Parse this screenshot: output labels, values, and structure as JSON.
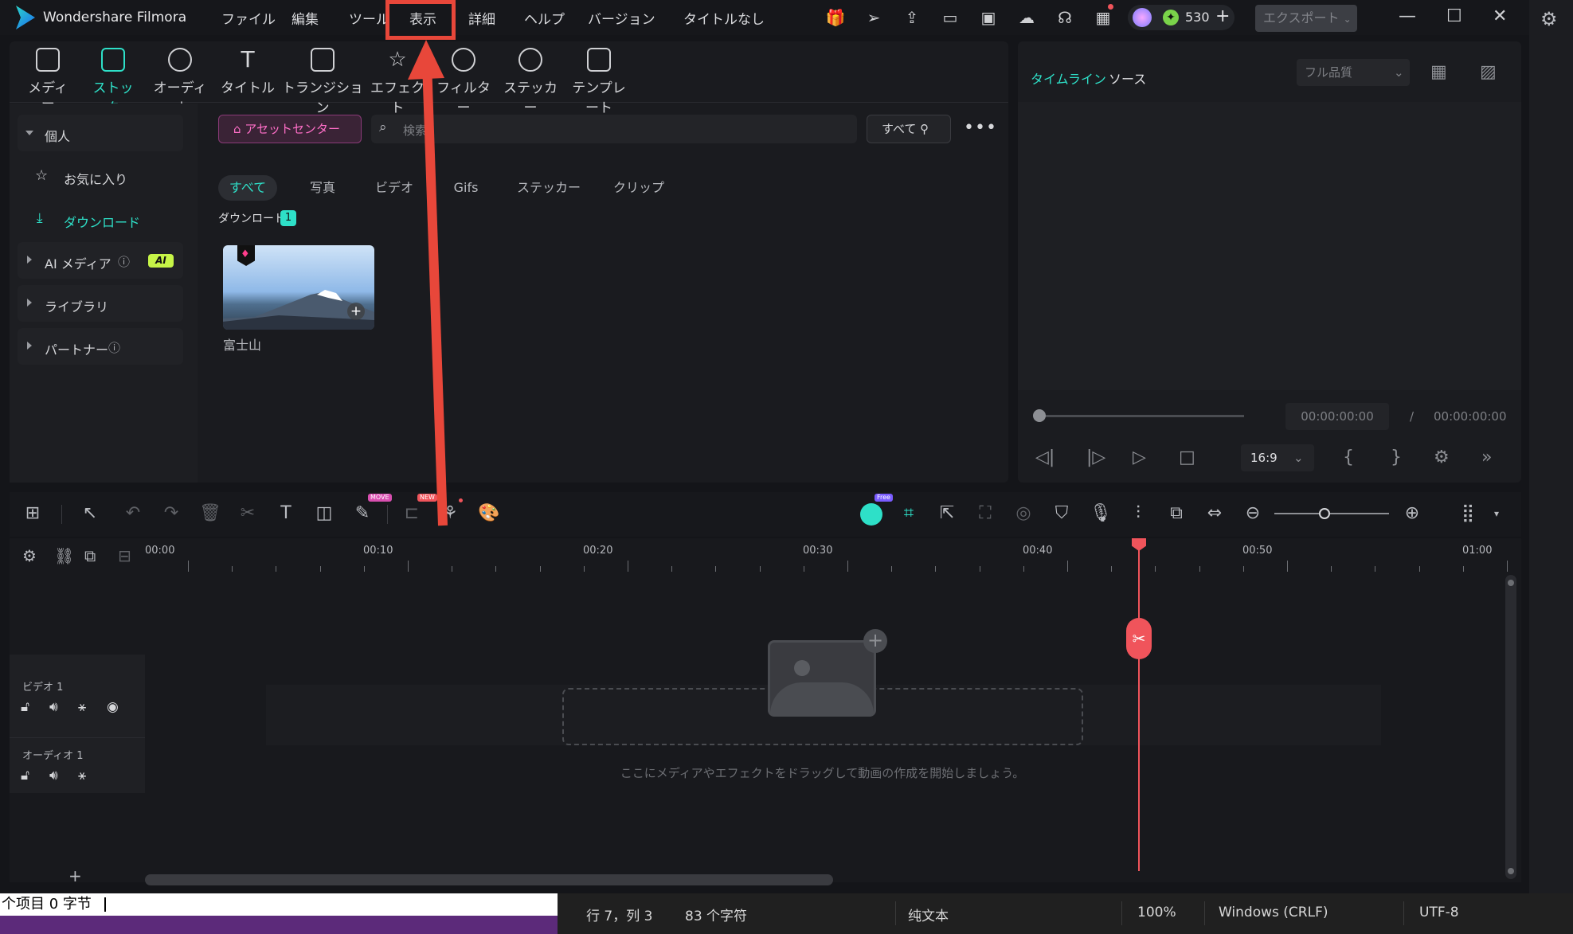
{
  "app": {
    "name": "Wondershare Filmora",
    "project_title": "タイトルなし",
    "credits": "530",
    "export_label": "エクスポート"
  },
  "menu": [
    "ファイル",
    "編集",
    "ツール",
    "表示",
    "詳細",
    "ヘルプ",
    "バージョン"
  ],
  "tool_tabs": [
    "メディア",
    "ストック",
    "オーディオ",
    "タイトル",
    "トランジション",
    "エフェクト",
    "フィルター",
    "ステッカー",
    "テンプレート"
  ],
  "sidebar": {
    "personal": "個人",
    "favorites": "お気に入り",
    "download": "ダウンロード",
    "ai_media": "AI メディア",
    "ai_badge": "AI",
    "library": "ライブラリ",
    "partner": "パートナー"
  },
  "stock": {
    "asset_center": "アセットセンター",
    "search_placeholder": "検索",
    "filter_all": "すべて",
    "filters": [
      "すべて",
      "写真",
      "ビデオ",
      "Gifs",
      "ステッカー",
      "クリップ"
    ],
    "section_label": "ダウンロード",
    "section_count": "1",
    "thumbnail_caption": "富士山"
  },
  "preview": {
    "tab_timeline": "タイムライン",
    "tab_source": "ソース",
    "quality": "フル品質",
    "current_time": "00:00:00:00",
    "separator": "/",
    "total_time": "00:00:00:00",
    "aspect_ratio": "16:9"
  },
  "timeline": {
    "ticks": [
      "00:00",
      "00:10",
      "00:20",
      "00:30",
      "00:40",
      "00:50",
      "01:00"
    ],
    "video_track": "ビデオ 1",
    "audio_track": "オーディオ 1",
    "drop_hint": "ここにメディアやエフェクトをドラッグして動画の作成を開始しましょう。",
    "badge_move": "MOVE",
    "badge_new": "NEW",
    "badge_free": "Free",
    "add_track": "+"
  },
  "statusbar": {
    "left_text": "个项目  0 字节",
    "position": "行 7，列 3",
    "chars": "83 个字符",
    "mode": "纯文本",
    "zoom": "100%",
    "eol": "Windows (CRLF)",
    "encoding": "UTF-8"
  },
  "colors": {
    "accent": "#2ee0c8",
    "highlight": "#e8473a",
    "playhead": "#f0545b",
    "asset_center": "#ff6fc8"
  }
}
